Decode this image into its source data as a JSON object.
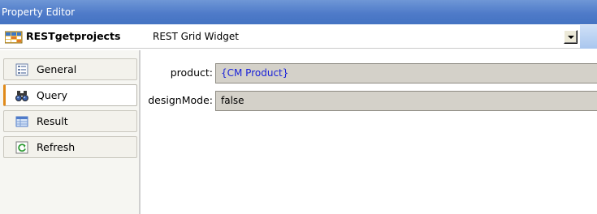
{
  "window": {
    "title": "Property Editor"
  },
  "object_bar": {
    "name": "RESTgetprojects",
    "type": "REST Grid Widget"
  },
  "sidebar": {
    "items": [
      {
        "label": "General",
        "icon": "general-page-icon",
        "active": false
      },
      {
        "label": "Query",
        "icon": "binoculars-icon",
        "active": true
      },
      {
        "label": "Result",
        "icon": "result-grid-icon",
        "active": false
      },
      {
        "label": "Refresh",
        "icon": "refresh-icon",
        "active": false
      }
    ]
  },
  "properties": [
    {
      "label": "product:",
      "value": "{CM Product}"
    },
    {
      "label": "designMode:",
      "value": "false"
    }
  ],
  "colors": {
    "titlebar": "#4f7bc9",
    "field_bg": "#d4d1c9",
    "link_text": "#1a22d8",
    "active_accent": "#e08a1a"
  }
}
